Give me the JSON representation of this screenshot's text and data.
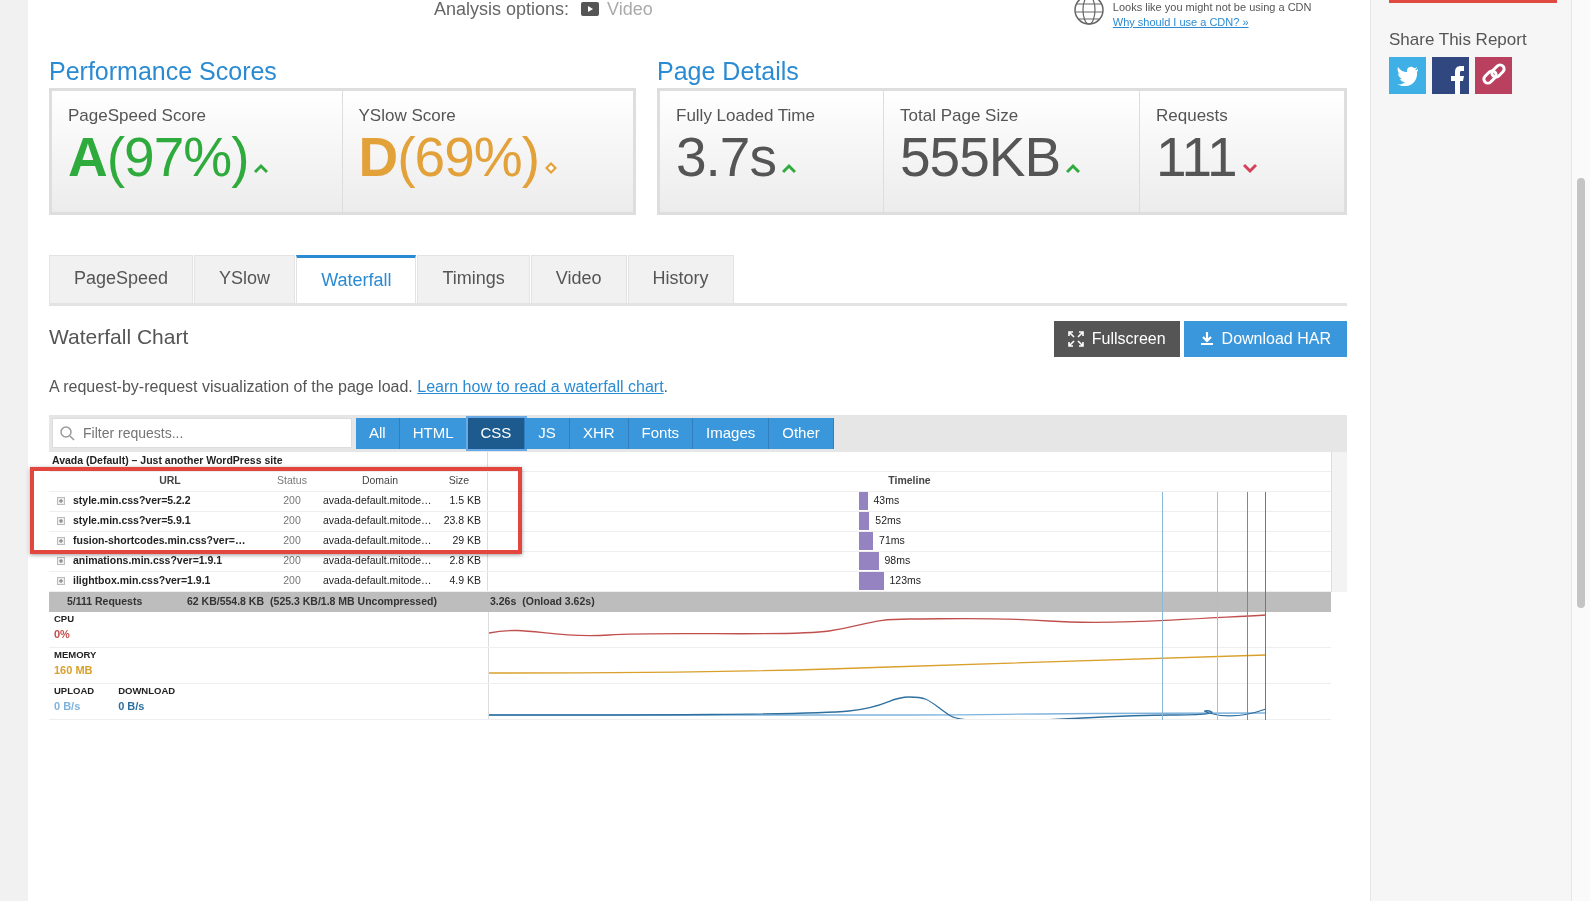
{
  "header": {
    "analysis_label": "Analysis options:",
    "video_option": "Video",
    "cdn_notice": "Looks like you might not be using a CDN",
    "cdn_link": "Why should I use a CDN? »"
  },
  "performance": {
    "title": "Performance Scores",
    "scores": [
      {
        "label": "PageSpeed Score",
        "grade": "A",
        "percent": "(97%)",
        "kind": "up",
        "color": "#2faa3c"
      },
      {
        "label": "YSlow Score",
        "grade": "D",
        "percent": "(69%)",
        "kind": "same",
        "color": "#e3a13a"
      }
    ]
  },
  "page_details": {
    "title": "Page Details",
    "metrics": [
      {
        "label": "Fully Loaded Time",
        "value": "3.7s",
        "kind": "up"
      },
      {
        "label": "Total Page Size",
        "value": "555KB",
        "kind": "up"
      },
      {
        "label": "Requests",
        "value": "111",
        "kind": "down"
      }
    ]
  },
  "tabs": [
    {
      "label": "PageSpeed",
      "selected": false
    },
    {
      "label": "YSlow",
      "selected": false
    },
    {
      "label": "Waterfall",
      "selected": true
    },
    {
      "label": "Timings",
      "selected": false
    },
    {
      "label": "Video",
      "selected": false
    },
    {
      "label": "History",
      "selected": false
    }
  ],
  "waterfall": {
    "title": "Waterfall Chart",
    "buttons": [
      {
        "label": "Fullscreen",
        "kind": "fullscreen"
      },
      {
        "label": "Download HAR",
        "kind": "download"
      }
    ],
    "description": "A request-by-request visualization of the page load.",
    "link": "Learn how to read a waterfall chart",
    "description_end": ".",
    "filter": {
      "placeholder": "Filter requests...",
      "types": [
        {
          "label": "All",
          "selected": false
        },
        {
          "label": "HTML",
          "selected": false
        },
        {
          "label": "CSS",
          "selected": true
        },
        {
          "label": "JS",
          "selected": false
        },
        {
          "label": "XHR",
          "selected": false
        },
        {
          "label": "Fonts",
          "selected": false
        },
        {
          "label": "Images",
          "selected": false
        },
        {
          "label": "Other",
          "selected": false
        }
      ]
    },
    "site_title": "Avada (Default) – Just another WordPress site",
    "columns": [
      "URL",
      "Status",
      "Domain",
      "Size",
      "Timeline"
    ],
    "rows": [
      {
        "url": "style.min.css?ver=5.2.2",
        "status": "200",
        "domain": "avada-default.mitode…",
        "size": "1.5 KB",
        "time": "43ms",
        "highlighted": true
      },
      {
        "url": "style.min.css?ver=5.9.1",
        "status": "200",
        "domain": "avada-default.mitode…",
        "size": "23.8 KB",
        "time": "52ms",
        "highlighted": true
      },
      {
        "url": "fusion-shortcodes.min.css?ver=…",
        "status": "200",
        "domain": "avada-default.mitode…",
        "size": "29 KB",
        "time": "71ms",
        "highlighted": true
      },
      {
        "url": "animations.min.css?ver=1.9.1",
        "status": "200",
        "domain": "avada-default.mitode…",
        "size": "2.8 KB",
        "time": "98ms",
        "highlighted": false
      },
      {
        "url": "ilightbox.min.css?ver=1.9.1",
        "status": "200",
        "domain": "avada-default.mitode…",
        "size": "4.9 KB",
        "time": "123ms",
        "highlighted": false
      }
    ],
    "summary": {
      "requests": "5/111 Requests",
      "size": "62 KB/554.8 KB",
      "uncompressed": "(525.3 KB/1.8 MB Uncompressed)",
      "load": "3.26s",
      "onload": "(Onload 3.62s)"
    },
    "resources": [
      {
        "label": "CPU",
        "value": "0%",
        "color": "#c0504d"
      },
      {
        "label": "MEMORY",
        "value": "160 MB",
        "color": "#d9a02c"
      },
      {
        "label": "UPLOAD",
        "value": "0 B/s",
        "color": "#7fb3dc"
      },
      {
        "label": "DOWNLOAD",
        "value": "0 B/s",
        "color": "#2e6fa0"
      }
    ]
  },
  "sidebar": {
    "share_title": "Share This Report",
    "share": [
      {
        "kind": "twitter"
      },
      {
        "kind": "facebook"
      },
      {
        "kind": "link"
      }
    ]
  }
}
